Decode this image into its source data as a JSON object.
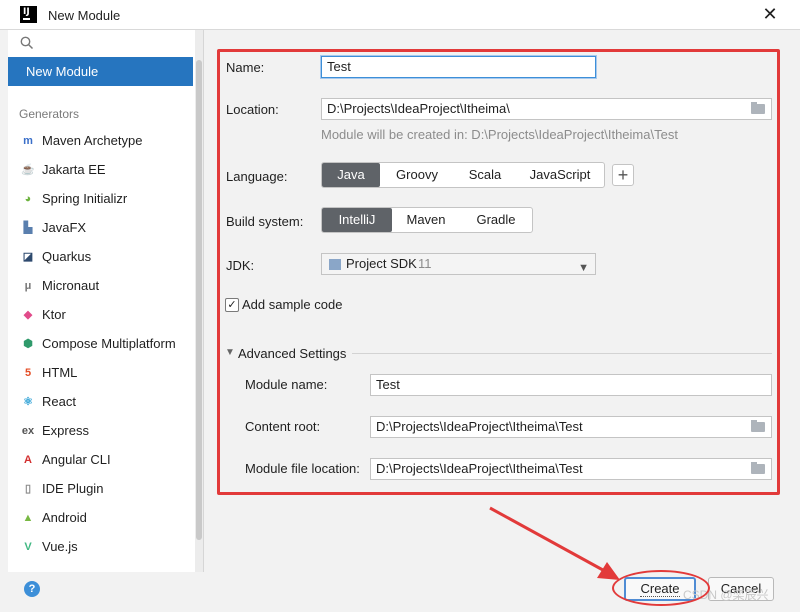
{
  "window": {
    "title": "New Module",
    "app_icon_text": "IJ"
  },
  "sidebar": {
    "active_item": "New Module",
    "section_label": "Generators",
    "items": [
      {
        "label": "Maven Archetype",
        "icon": "maven-icon",
        "color": "#3a6fc9"
      },
      {
        "label": "Jakarta EE",
        "icon": "jakarta-icon",
        "color": "#e8832a"
      },
      {
        "label": "Spring Initializr",
        "icon": "spring-icon",
        "color": "#6db33f"
      },
      {
        "label": "JavaFX",
        "icon": "javafx-icon",
        "color": "#5a7fae"
      },
      {
        "label": "Quarkus",
        "icon": "quarkus-icon",
        "color": "#2e4a6e"
      },
      {
        "label": "Micronaut",
        "icon": "micronaut-icon",
        "color": "#777777"
      },
      {
        "label": "Ktor",
        "icon": "ktor-icon",
        "color": "#e14b8a"
      },
      {
        "label": "Compose Multiplatform",
        "icon": "compose-icon",
        "color": "#2f9a6b"
      },
      {
        "label": "HTML",
        "icon": "html-icon",
        "color": "#e44d26"
      },
      {
        "label": "React",
        "icon": "react-icon",
        "color": "#39a6d8"
      },
      {
        "label": "Express",
        "icon": "express-icon",
        "color": "#555555"
      },
      {
        "label": "Angular CLI",
        "icon": "angular-icon",
        "color": "#d32f2f"
      },
      {
        "label": "IDE Plugin",
        "icon": "ide-plugin-icon",
        "color": "#8a8a8a"
      },
      {
        "label": "Android",
        "icon": "android-icon",
        "color": "#78b843"
      },
      {
        "label": "Vue.js",
        "icon": "vue-icon",
        "color": "#41b883"
      }
    ]
  },
  "form": {
    "name_label": "Name:",
    "name_value": "Test",
    "location_label": "Location:",
    "location_value": "D:\\Projects\\IdeaProject\\Itheima\\",
    "location_hint": "Module will be created in: D:\\Projects\\IdeaProject\\Itheima\\Test",
    "language_label": "Language:",
    "languages": [
      "Java",
      "Groovy",
      "Scala",
      "JavaScript"
    ],
    "selected_language": "Java",
    "add_language_label": "+",
    "build_label": "Build system:",
    "build_systems": [
      "IntelliJ",
      "Maven",
      "Gradle"
    ],
    "selected_build": "IntelliJ",
    "jdk_label": "JDK:",
    "jdk_value": "Project SDK",
    "jdk_version": "11",
    "sample_code_label": "Add sample code",
    "sample_code_checked": true,
    "advanced_label": "Advanced Settings",
    "module_name_label": "Module name:",
    "module_name_value": "Test",
    "content_root_label": "Content root:",
    "content_root_value": "D:\\Projects\\IdeaProject\\Itheima\\Test",
    "module_file_label": "Module file location:",
    "module_file_value": "D:\\Projects\\IdeaProject\\Itheima\\Test"
  },
  "footer": {
    "help_label": "?",
    "create_label": "Create",
    "cancel_label": "Cancel",
    "watermark": "CSDN @栾辰兴"
  },
  "colors": {
    "accent": "#2675bf",
    "annotation": "#e23a3a"
  }
}
